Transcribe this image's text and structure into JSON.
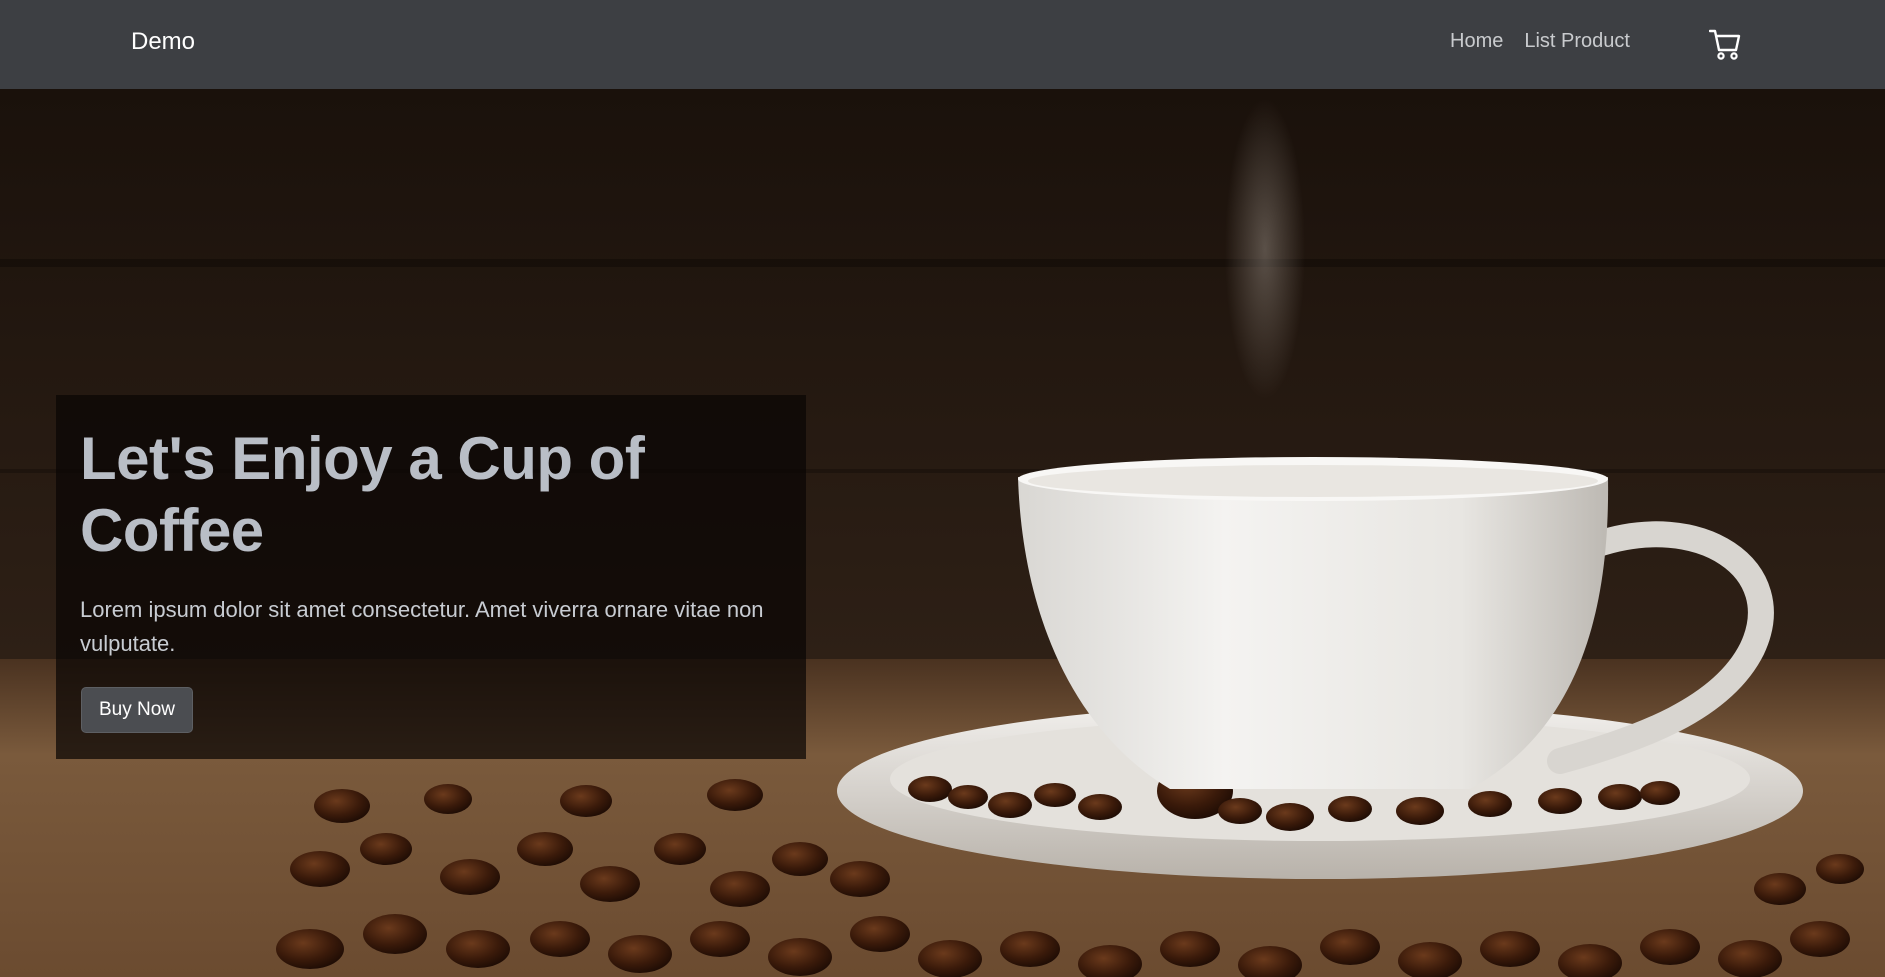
{
  "navbar": {
    "brand": "Demo",
    "links": [
      {
        "label": "Home"
      },
      {
        "label": "List Product"
      }
    ],
    "cart_icon": "shopping-cart-icon"
  },
  "hero": {
    "title": "Let's Enjoy a Cup of Coffee",
    "text": "Lorem ipsum dolor sit amet consectetur. Amet viverra ornare vitae non vulputate.",
    "button_label": "Buy Now",
    "image": "coffee cup on saucer with coffee beans on burlap"
  },
  "colors": {
    "navbar_bg": "#3d3f43",
    "title_color": "#b9bec6",
    "button_bg": "#4b4d51"
  }
}
